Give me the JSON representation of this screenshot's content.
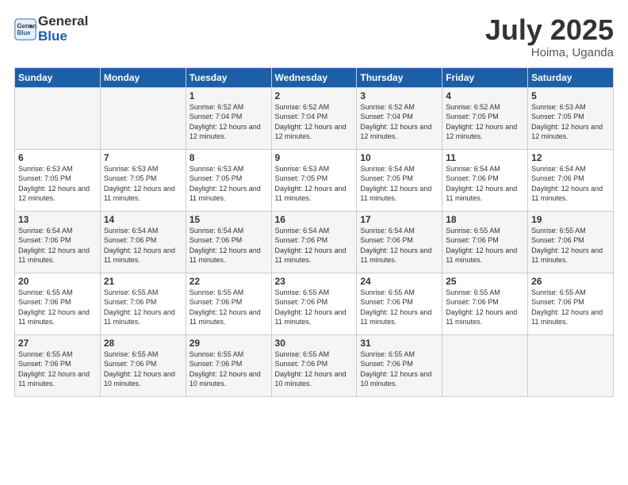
{
  "logo": {
    "line1": "General",
    "line2": "Blue"
  },
  "title": "July 2025",
  "location": "Hoima, Uganda",
  "weekdays": [
    "Sunday",
    "Monday",
    "Tuesday",
    "Wednesday",
    "Thursday",
    "Friday",
    "Saturday"
  ],
  "weeks": [
    [
      {
        "day": null,
        "sunrise": null,
        "sunset": null,
        "daylight": null
      },
      {
        "day": null,
        "sunrise": null,
        "sunset": null,
        "daylight": null
      },
      {
        "day": "1",
        "sunrise": "Sunrise: 6:52 AM",
        "sunset": "Sunset: 7:04 PM",
        "daylight": "Daylight: 12 hours and 12 minutes."
      },
      {
        "day": "2",
        "sunrise": "Sunrise: 6:52 AM",
        "sunset": "Sunset: 7:04 PM",
        "daylight": "Daylight: 12 hours and 12 minutes."
      },
      {
        "day": "3",
        "sunrise": "Sunrise: 6:52 AM",
        "sunset": "Sunset: 7:04 PM",
        "daylight": "Daylight: 12 hours and 12 minutes."
      },
      {
        "day": "4",
        "sunrise": "Sunrise: 6:52 AM",
        "sunset": "Sunset: 7:05 PM",
        "daylight": "Daylight: 12 hours and 12 minutes."
      },
      {
        "day": "5",
        "sunrise": "Sunrise: 6:53 AM",
        "sunset": "Sunset: 7:05 PM",
        "daylight": "Daylight: 12 hours and 12 minutes."
      }
    ],
    [
      {
        "day": "6",
        "sunrise": "Sunrise: 6:53 AM",
        "sunset": "Sunset: 7:05 PM",
        "daylight": "Daylight: 12 hours and 12 minutes."
      },
      {
        "day": "7",
        "sunrise": "Sunrise: 6:53 AM",
        "sunset": "Sunset: 7:05 PM",
        "daylight": "Daylight: 12 hours and 11 minutes."
      },
      {
        "day": "8",
        "sunrise": "Sunrise: 6:53 AM",
        "sunset": "Sunset: 7:05 PM",
        "daylight": "Daylight: 12 hours and 11 minutes."
      },
      {
        "day": "9",
        "sunrise": "Sunrise: 6:53 AM",
        "sunset": "Sunset: 7:05 PM",
        "daylight": "Daylight: 12 hours and 11 minutes."
      },
      {
        "day": "10",
        "sunrise": "Sunrise: 6:54 AM",
        "sunset": "Sunset: 7:05 PM",
        "daylight": "Daylight: 12 hours and 11 minutes."
      },
      {
        "day": "11",
        "sunrise": "Sunrise: 6:54 AM",
        "sunset": "Sunset: 7:06 PM",
        "daylight": "Daylight: 12 hours and 11 minutes."
      },
      {
        "day": "12",
        "sunrise": "Sunrise: 6:54 AM",
        "sunset": "Sunset: 7:06 PM",
        "daylight": "Daylight: 12 hours and 11 minutes."
      }
    ],
    [
      {
        "day": "13",
        "sunrise": "Sunrise: 6:54 AM",
        "sunset": "Sunset: 7:06 PM",
        "daylight": "Daylight: 12 hours and 11 minutes."
      },
      {
        "day": "14",
        "sunrise": "Sunrise: 6:54 AM",
        "sunset": "Sunset: 7:06 PM",
        "daylight": "Daylight: 12 hours and 11 minutes."
      },
      {
        "day": "15",
        "sunrise": "Sunrise: 6:54 AM",
        "sunset": "Sunset: 7:06 PM",
        "daylight": "Daylight: 12 hours and 11 minutes."
      },
      {
        "day": "16",
        "sunrise": "Sunrise: 6:54 AM",
        "sunset": "Sunset: 7:06 PM",
        "daylight": "Daylight: 12 hours and 11 minutes."
      },
      {
        "day": "17",
        "sunrise": "Sunrise: 6:54 AM",
        "sunset": "Sunset: 7:06 PM",
        "daylight": "Daylight: 12 hours and 11 minutes."
      },
      {
        "day": "18",
        "sunrise": "Sunrise: 6:55 AM",
        "sunset": "Sunset: 7:06 PM",
        "daylight": "Daylight: 12 hours and 11 minutes."
      },
      {
        "day": "19",
        "sunrise": "Sunrise: 6:55 AM",
        "sunset": "Sunset: 7:06 PM",
        "daylight": "Daylight: 12 hours and 11 minutes."
      }
    ],
    [
      {
        "day": "20",
        "sunrise": "Sunrise: 6:55 AM",
        "sunset": "Sunset: 7:06 PM",
        "daylight": "Daylight: 12 hours and 11 minutes."
      },
      {
        "day": "21",
        "sunrise": "Sunrise: 6:55 AM",
        "sunset": "Sunset: 7:06 PM",
        "daylight": "Daylight: 12 hours and 11 minutes."
      },
      {
        "day": "22",
        "sunrise": "Sunrise: 6:55 AM",
        "sunset": "Sunset: 7:06 PM",
        "daylight": "Daylight: 12 hours and 11 minutes."
      },
      {
        "day": "23",
        "sunrise": "Sunrise: 6:55 AM",
        "sunset": "Sunset: 7:06 PM",
        "daylight": "Daylight: 12 hours and 11 minutes."
      },
      {
        "day": "24",
        "sunrise": "Sunrise: 6:55 AM",
        "sunset": "Sunset: 7:06 PM",
        "daylight": "Daylight: 12 hours and 11 minutes."
      },
      {
        "day": "25",
        "sunrise": "Sunrise: 6:55 AM",
        "sunset": "Sunset: 7:06 PM",
        "daylight": "Daylight: 12 hours and 11 minutes."
      },
      {
        "day": "26",
        "sunrise": "Sunrise: 6:55 AM",
        "sunset": "Sunset: 7:06 PM",
        "daylight": "Daylight: 12 hours and 11 minutes."
      }
    ],
    [
      {
        "day": "27",
        "sunrise": "Sunrise: 6:55 AM",
        "sunset": "Sunset: 7:06 PM",
        "daylight": "Daylight: 12 hours and 11 minutes."
      },
      {
        "day": "28",
        "sunrise": "Sunrise: 6:55 AM",
        "sunset": "Sunset: 7:06 PM",
        "daylight": "Daylight: 12 hours and 10 minutes."
      },
      {
        "day": "29",
        "sunrise": "Sunrise: 6:55 AM",
        "sunset": "Sunset: 7:06 PM",
        "daylight": "Daylight: 12 hours and 10 minutes."
      },
      {
        "day": "30",
        "sunrise": "Sunrise: 6:55 AM",
        "sunset": "Sunset: 7:06 PM",
        "daylight": "Daylight: 12 hours and 10 minutes."
      },
      {
        "day": "31",
        "sunrise": "Sunrise: 6:55 AM",
        "sunset": "Sunset: 7:06 PM",
        "daylight": "Daylight: 12 hours and 10 minutes."
      },
      {
        "day": null,
        "sunrise": null,
        "sunset": null,
        "daylight": null
      },
      {
        "day": null,
        "sunrise": null,
        "sunset": null,
        "daylight": null
      }
    ]
  ]
}
